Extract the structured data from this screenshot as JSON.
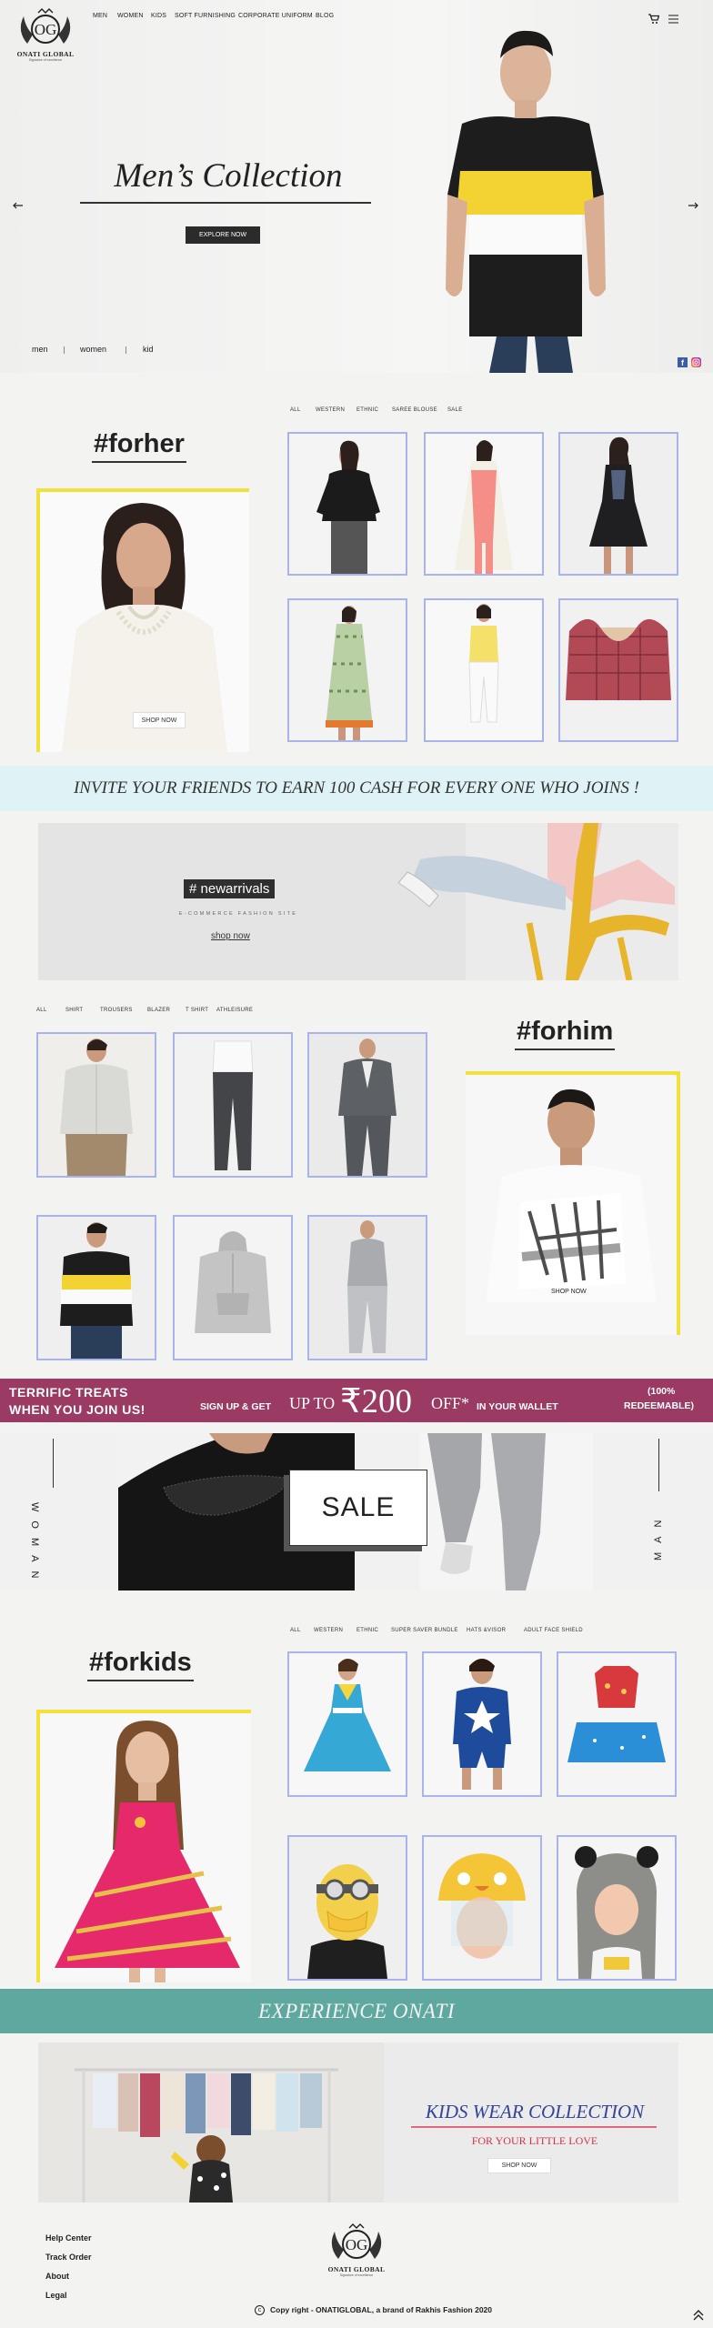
{
  "brand": {
    "name": "ONATI GLOBAL",
    "tagline": "Signature of excellence"
  },
  "nav": {
    "items": [
      "MEN",
      "WOMEN",
      "KIDS",
      "SOFT FURNISHING",
      "CORPORATE UNIFORM",
      "BLOG"
    ]
  },
  "hero": {
    "title": "Men’s Collection",
    "cta": "EXPLORE NOW",
    "links": [
      "men",
      "women",
      "kid"
    ]
  },
  "forher": {
    "tabs": [
      "ALL",
      "WESTERN",
      "ETHNIC",
      "SAREE BLOUSE",
      "SALE"
    ],
    "heading": "#forher",
    "cta": "SHOP NOW"
  },
  "invite": {
    "text": "INVITE YOUR FRIENDS TO  EARN  100 CASH FOR EVERY ONE WHO JOINS !"
  },
  "newarrivals": {
    "tag": "# newarrivals",
    "subtitle": "E-COMMERCE FASHION SITE",
    "cta": "shop now"
  },
  "forhim": {
    "tabs": [
      "ALL",
      "SHIRT",
      "TROUSERS",
      "BLAZER",
      "T SHIRT",
      "ATHLEISURE"
    ],
    "heading": "#forhim",
    "cta": "SHOP NOW"
  },
  "promo": {
    "line1": "TERRIFIC TREATS",
    "line2": "WHEN YOU JOIN US!",
    "signup": "SIGN UP & GET",
    "upto": "UP TO",
    "amount": "₹200",
    "off": "OFF*",
    "wallet": "IN YOUR  WALLET",
    "redeem1": "(100%",
    "redeem2": "REDEEMABLE)"
  },
  "sale": {
    "label": "SALE",
    "left": "WOMAN",
    "right": "MAN"
  },
  "forkids": {
    "tabs": [
      "ALL",
      "WESTERN",
      "ETHNIC",
      "SUPER SAVER BUNDLE",
      "HATS &VISOR",
      "ADULT FACE SHIELD"
    ],
    "heading": "#forkids"
  },
  "experience": {
    "text": "EXPERIENCE ONATI"
  },
  "kidswear": {
    "title": "KIDS WEAR COLLECTION",
    "subtitle": "FOR YOUR LITTLE LOVE",
    "cta": "SHOP NOW"
  },
  "footer": {
    "links": [
      "Help Center",
      "Track Order",
      "About",
      "Legal"
    ],
    "copyright": "Copy right - ONATIGLOBAL, a brand of Rakhis Fashion 2020"
  },
  "colors": {
    "accent_yellow": "#f2e13d",
    "tile_border": "#a9b4ef",
    "promo_bg": "#9b3a63",
    "teal": "#5fa8a0",
    "invite_bg": "#dff3f6"
  }
}
